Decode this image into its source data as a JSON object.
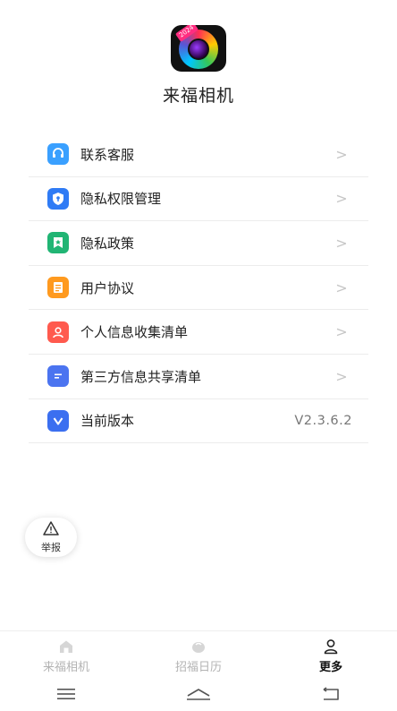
{
  "app": {
    "name": "来福相机",
    "logo_badge": "2024"
  },
  "menu": [
    {
      "label": "联系客服",
      "icon": "headset-icon",
      "trailing": ">"
    },
    {
      "label": "隐私权限管理",
      "icon": "shield-lock-icon",
      "trailing": ">"
    },
    {
      "label": "隐私政策",
      "icon": "bookmark-star-icon",
      "trailing": ">"
    },
    {
      "label": "用户协议",
      "icon": "document-icon",
      "trailing": ">"
    },
    {
      "label": "个人信息收集清单",
      "icon": "person-icon",
      "trailing": ">"
    },
    {
      "label": "第三方信息共享清单",
      "icon": "list-icon",
      "trailing": ">"
    },
    {
      "label": "当前版本",
      "icon": "version-v-icon",
      "trailing": "V2.3.6.2"
    }
  ],
  "report": {
    "label": "举报",
    "icon": "warning-icon"
  },
  "tabs": [
    {
      "label": "来福相机",
      "icon": "home-icon",
      "active": false
    },
    {
      "label": "招福日历",
      "icon": "calendar-icon",
      "active": false
    },
    {
      "label": "更多",
      "icon": "user-icon",
      "active": true
    }
  ],
  "system_nav": [
    "menu-icon",
    "home-icon",
    "back-icon"
  ],
  "colors": {
    "accent_blue": "#3aa0ff",
    "divider": "#ececec",
    "active_tab": "#111111",
    "inactive_tab": "#b3b3b3"
  }
}
